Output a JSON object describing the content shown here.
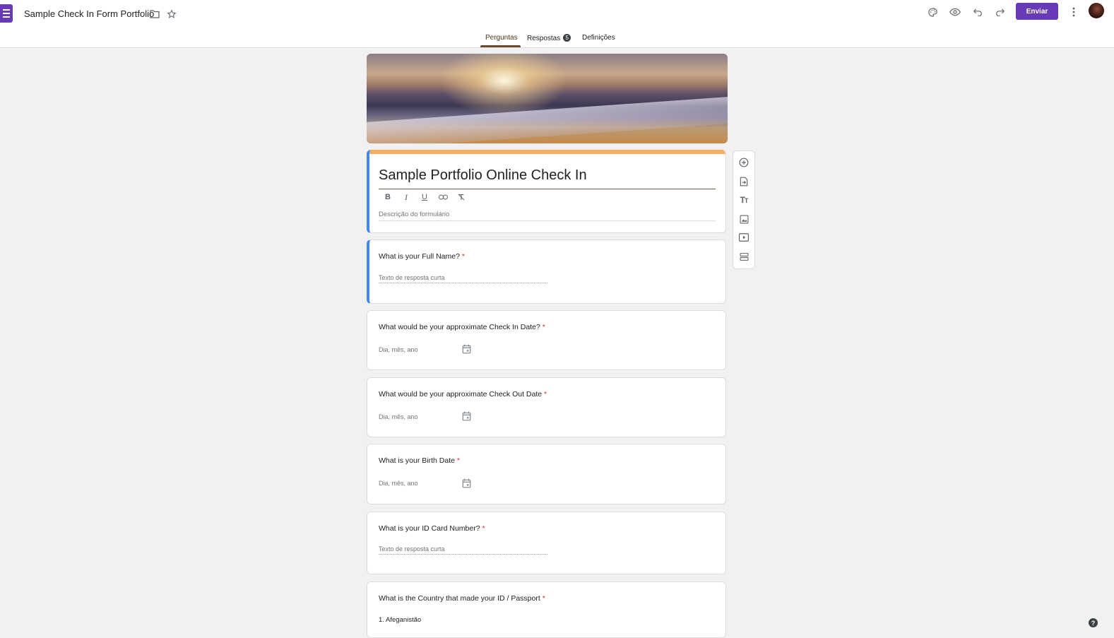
{
  "header": {
    "doc_title": "Sample Check In Form Portfolio",
    "send_label": "Enviar"
  },
  "tabs": [
    {
      "label": "Perguntas",
      "active": true
    },
    {
      "label": "Respostas",
      "badge": "5"
    },
    {
      "label": "Definições"
    }
  ],
  "form": {
    "title": "Sample Portfolio Online Check In",
    "description_placeholder": "Descrição do formulário",
    "accent_color": "#673ab7",
    "theme_strip_color": "#f4b060"
  },
  "questions": [
    {
      "title": "What is your Full Name?",
      "required": "*",
      "type": "short",
      "placeholder": "Texto de resposta curta"
    },
    {
      "title": "What would be your approximate Check In Date?",
      "required": "*",
      "type": "date",
      "placeholder": "Dia, mês, ano"
    },
    {
      "title": "What would be your approximate Check Out Date",
      "required": "*",
      "type": "date",
      "placeholder": "Dia, mês, ano"
    },
    {
      "title": "What is your Birth Date",
      "required": "*",
      "type": "date",
      "placeholder": "Dia, mês, ano"
    },
    {
      "title": "What is your ID Card Number?",
      "required": "*",
      "type": "short",
      "placeholder": "Texto de resposta curta"
    },
    {
      "title": "What is the Country that made your ID / Passport",
      "required": "*",
      "type": "dropdown",
      "first_option": "1.   Afeganistão"
    }
  ],
  "toolbar_icons": [
    "add-question-icon",
    "import-questions-icon",
    "add-title-icon",
    "add-image-icon",
    "add-video-icon",
    "add-section-icon"
  ],
  "help_glyph": "?"
}
